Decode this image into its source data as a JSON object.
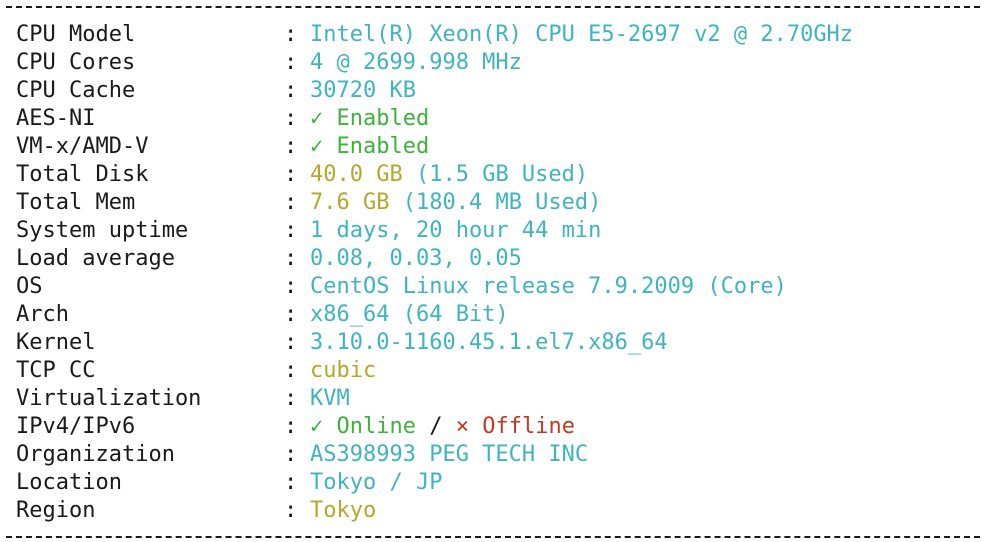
{
  "separator": "--------------------------------------------------------------------------------",
  "colon": ":",
  "rows": {
    "cpu_model": {
      "label": "CPU Model",
      "value": "Intel(R) Xeon(R) CPU E5-2697 v2 @ 2.70GHz"
    },
    "cpu_cores": {
      "label": "CPU Cores",
      "value": "4 @ 2699.998 MHz"
    },
    "cpu_cache": {
      "label": "CPU Cache",
      "value": "30720 KB"
    },
    "aes_ni": {
      "label": "AES-NI",
      "icon": "check-icon",
      "check_glyph": "✓",
      "value": "Enabled"
    },
    "vmx": {
      "label": "VM-x/AMD-V",
      "icon": "check-icon",
      "check_glyph": "✓",
      "value": "Enabled"
    },
    "total_disk": {
      "label": "Total Disk",
      "value": "40.0 GB",
      "used": "(1.5 GB Used)"
    },
    "total_mem": {
      "label": "Total Mem",
      "value": "7.6 GB",
      "used": "(180.4 MB Used)"
    },
    "uptime": {
      "label": "System uptime",
      "value": "1 days, 20 hour 44 min"
    },
    "load_average": {
      "label": "Load average",
      "value": "0.08, 0.03, 0.05"
    },
    "os": {
      "label": "OS",
      "value": "CentOS Linux release 7.9.2009 (Core)"
    },
    "arch": {
      "label": "Arch",
      "value": "x86_64 (64 Bit)"
    },
    "kernel": {
      "label": "Kernel",
      "value": "3.10.0-1160.45.1.el7.x86_64"
    },
    "tcp_cc": {
      "label": "TCP CC",
      "value": "cubic"
    },
    "virtualization": {
      "label": "Virtualization",
      "value": "KVM"
    },
    "ip": {
      "label": "IPv4/IPv6",
      "ipv4_glyph": "✓",
      "ipv4_status": "Online",
      "divider": "/",
      "ipv6_glyph": "×",
      "ipv6_status": "Offline"
    },
    "organization": {
      "label": "Organization",
      "value": "AS398993 PEG TECH INC"
    },
    "location": {
      "label": "Location",
      "value": "Tokyo / JP"
    },
    "region": {
      "label": "Region",
      "value": "Tokyo"
    }
  },
  "colors": {
    "cyan": "#3fb4c0",
    "green": "#3fb23a",
    "yellow": "#b3a82a",
    "red": "#c4391f",
    "text": "#1a1a1a"
  }
}
